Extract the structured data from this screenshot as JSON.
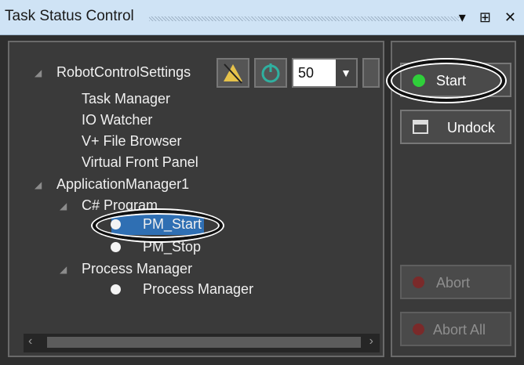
{
  "titlebar": {
    "title": "Task Status Control",
    "icons": "▾ ⊞ ✕"
  },
  "toolbar": {
    "combo_value": "50"
  },
  "tree": {
    "items": [
      {
        "label": "RobotControlSettings"
      },
      {
        "label": "Task Manager"
      },
      {
        "label": "IO Watcher"
      },
      {
        "label": "V+ File Browser"
      },
      {
        "label": "Virtual Front Panel"
      },
      {
        "label": "ApplicationManager1"
      },
      {
        "label": "C# Program"
      },
      {
        "label": "PM_Start"
      },
      {
        "label": "PM_Stop"
      },
      {
        "label": "Process Manager"
      },
      {
        "label": "Process Manager"
      }
    ]
  },
  "buttons": {
    "start": "Start",
    "undock": "Undock",
    "abort": "Abort",
    "abort_all": "Abort All"
  },
  "colors": {
    "titlebar": "#cfe3f5",
    "panel": "#3a3a3a",
    "selection": "#2f6fb3",
    "start_green": "#2fcf3a",
    "abort_red": "#7a2a2a"
  }
}
